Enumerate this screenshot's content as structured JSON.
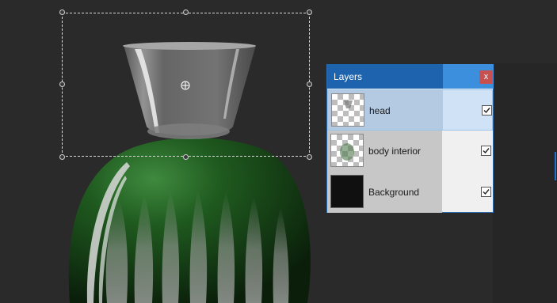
{
  "layers_panel": {
    "title": "Layers",
    "close_label": "x",
    "layers": [
      {
        "name": "head",
        "visible": true,
        "selected": true,
        "thumbnail": "transparent-checker"
      },
      {
        "name": "body interior",
        "visible": true,
        "selected": false,
        "thumbnail": "transparent-checker"
      },
      {
        "name": "Background",
        "visible": true,
        "selected": false,
        "thumbnail": "black-fill"
      }
    ]
  },
  "colors": {
    "canvas_bg": "#2a2a2a",
    "panel_header": "#1e63ad",
    "selection_row": "#cfe2f6",
    "close_button": "#c75050",
    "vase_green": "#1f5a1f"
  },
  "icons": {
    "move_handle": "crosshair-move-icon",
    "close": "close-icon",
    "visibility": "checkbox-check-icon"
  }
}
